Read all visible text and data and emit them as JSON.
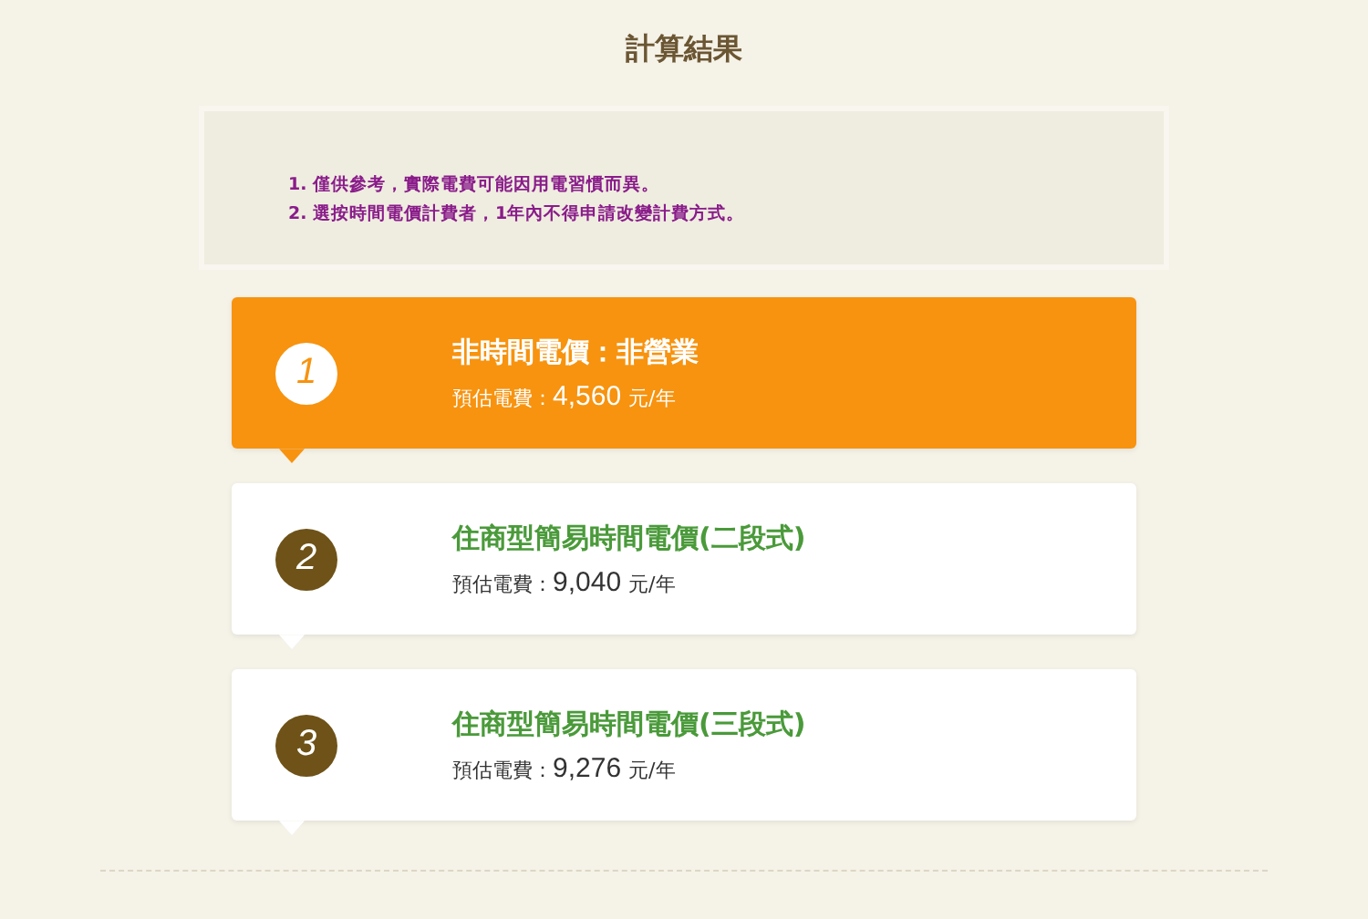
{
  "title": "計算結果",
  "notes": [
    "1. 僅供參考，實際電費可能因用電習慣而異。",
    "2. 選按時間電價計費者，1年內不得申請改變計費方式。"
  ],
  "results": [
    {
      "rank": "1",
      "title": "非時間電價：非營業",
      "label": "預估電費：",
      "amount": "4,560",
      "unit": "元/年",
      "selected": true
    },
    {
      "rank": "2",
      "title": "住商型簡易時間電價(二段式)",
      "label": "預估電費：",
      "amount": "9,040",
      "unit": "元/年",
      "selected": false
    },
    {
      "rank": "3",
      "title": "住商型簡易時間電價(三段式)",
      "label": "預估電費：",
      "amount": "9,276",
      "unit": "元/年",
      "selected": false
    }
  ]
}
